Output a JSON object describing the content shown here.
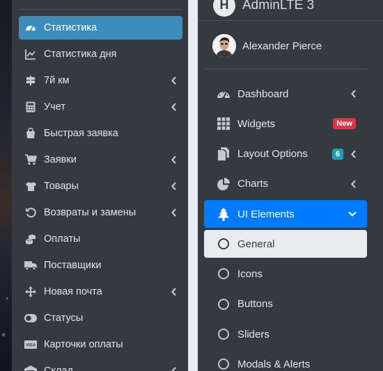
{
  "left_sidebar": {
    "items": [
      {
        "label": "Статистика",
        "icon": "speedometer-icon",
        "active": true,
        "chevron": false
      },
      {
        "label": "Статистика дня",
        "icon": "line-chart-icon",
        "active": false,
        "chevron": false
      },
      {
        "label": "7й км",
        "icon": "signpost-icon",
        "active": false,
        "chevron": true
      },
      {
        "label": "Учет",
        "icon": "calculator-icon",
        "active": false,
        "chevron": true
      },
      {
        "label": "Быстрая заявка",
        "icon": "shopping-bag-icon",
        "active": false,
        "chevron": false
      },
      {
        "label": "Заявки",
        "icon": "cart-icon",
        "active": false,
        "chevron": true
      },
      {
        "label": "Товары",
        "icon": "tshirt-icon",
        "active": false,
        "chevron": true
      },
      {
        "label": "Возвраты и замены",
        "icon": "undo-icon",
        "active": false,
        "chevron": true
      },
      {
        "label": "Оплаты",
        "icon": "coins-icon",
        "active": false,
        "chevron": false
      },
      {
        "label": "Поставщики",
        "icon": "truck-icon",
        "active": false,
        "chevron": false
      },
      {
        "label": "Новая почта",
        "icon": "move-arrows-icon",
        "active": false,
        "chevron": true
      },
      {
        "label": "Статусы",
        "icon": "toggle-icon",
        "active": false,
        "chevron": false
      },
      {
        "label": "Карточки оплаты",
        "icon": "visa-card-icon",
        "active": false,
        "chevron": false
      },
      {
        "label": "Склад",
        "icon": "warehouse-icon",
        "active": false,
        "chevron": true
      }
    ]
  },
  "right_sidebar": {
    "brand": {
      "logo_letter": "H",
      "title": "AdminLTE 3"
    },
    "user": {
      "name": "Alexander Pierce"
    },
    "items": [
      {
        "label": "Dashboard",
        "icon": "tachometer-icon",
        "chevron": true
      },
      {
        "label": "Widgets",
        "icon": "grid-icon",
        "badge": "New",
        "badge_color": "#dc3545"
      },
      {
        "label": "Layout Options",
        "icon": "copy-icon",
        "badge": "6",
        "badge_color": "#17a2b8",
        "chevron": true
      },
      {
        "label": "Charts",
        "icon": "pie-chart-icon",
        "chevron": true
      },
      {
        "label": "UI Elements",
        "icon": "tree-icon",
        "chevron_down": true,
        "open": true
      }
    ],
    "submenu": [
      {
        "label": "General",
        "current": true
      },
      {
        "label": "Icons"
      },
      {
        "label": "Buttons"
      },
      {
        "label": "Sliders"
      },
      {
        "label": "Modals & Alerts"
      }
    ]
  },
  "colors": {
    "sidebar_bg": "#343a40",
    "active_blue": "#3c8dbc",
    "open_blue": "#007bff",
    "current_bg": "#e9ecef"
  }
}
